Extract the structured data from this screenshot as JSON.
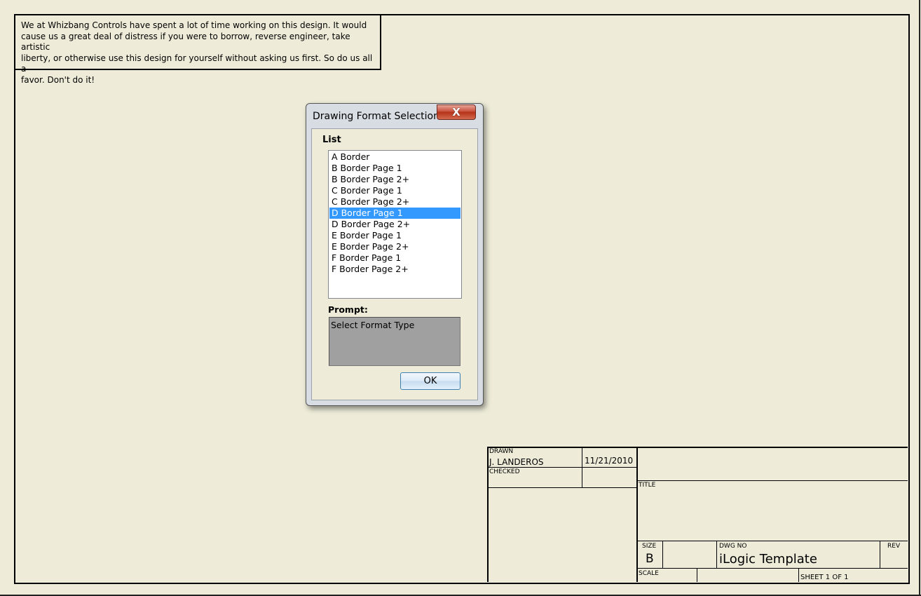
{
  "note": {
    "text": "We at Whizbang Controls have spent a lot of time working on this design.  It would\ncause us a great deal of distress if you were to borrow, reverse engineer, take artistic\nliberty, or otherwise use this design for yourself without asking us first.  So do us all a\nfavor.  Don't do it!"
  },
  "dialog": {
    "title": "Drawing Format Selection",
    "close_label": "X",
    "list_label": "List",
    "items": [
      "A Border",
      "B Border Page 1",
      "B Border Page 2+",
      "C Border Page 1",
      "C Border Page 2+",
      "D Border Page 1",
      "D Border Page 2+",
      "E Border Page 1",
      "E Border Page 2+",
      "F Border Page 1",
      "F Border Page 2+"
    ],
    "selected_index": 5,
    "prompt_label": "Prompt:",
    "prompt_text": "Select Format Type",
    "ok_label": "OK"
  },
  "title_block": {
    "drawn_label": "DRAWN",
    "drawn_by": "J. LANDEROS",
    "drawn_date": "11/21/2010",
    "checked_label": "CHECKED",
    "title_label": "TITLE",
    "size_label": "SIZE",
    "size_value": "B",
    "dwg_no_label": "DWG NO",
    "dwg_no_value": "iLogic Template",
    "rev_label": "REV",
    "scale_label": "SCALE",
    "sheet_text": "SHEET 1  OF 1"
  },
  "colors": {
    "paper": "#eeecd9",
    "selection": "#3399ff",
    "close_button": "#c8513d",
    "prompt_box": "#a0a0a0"
  }
}
